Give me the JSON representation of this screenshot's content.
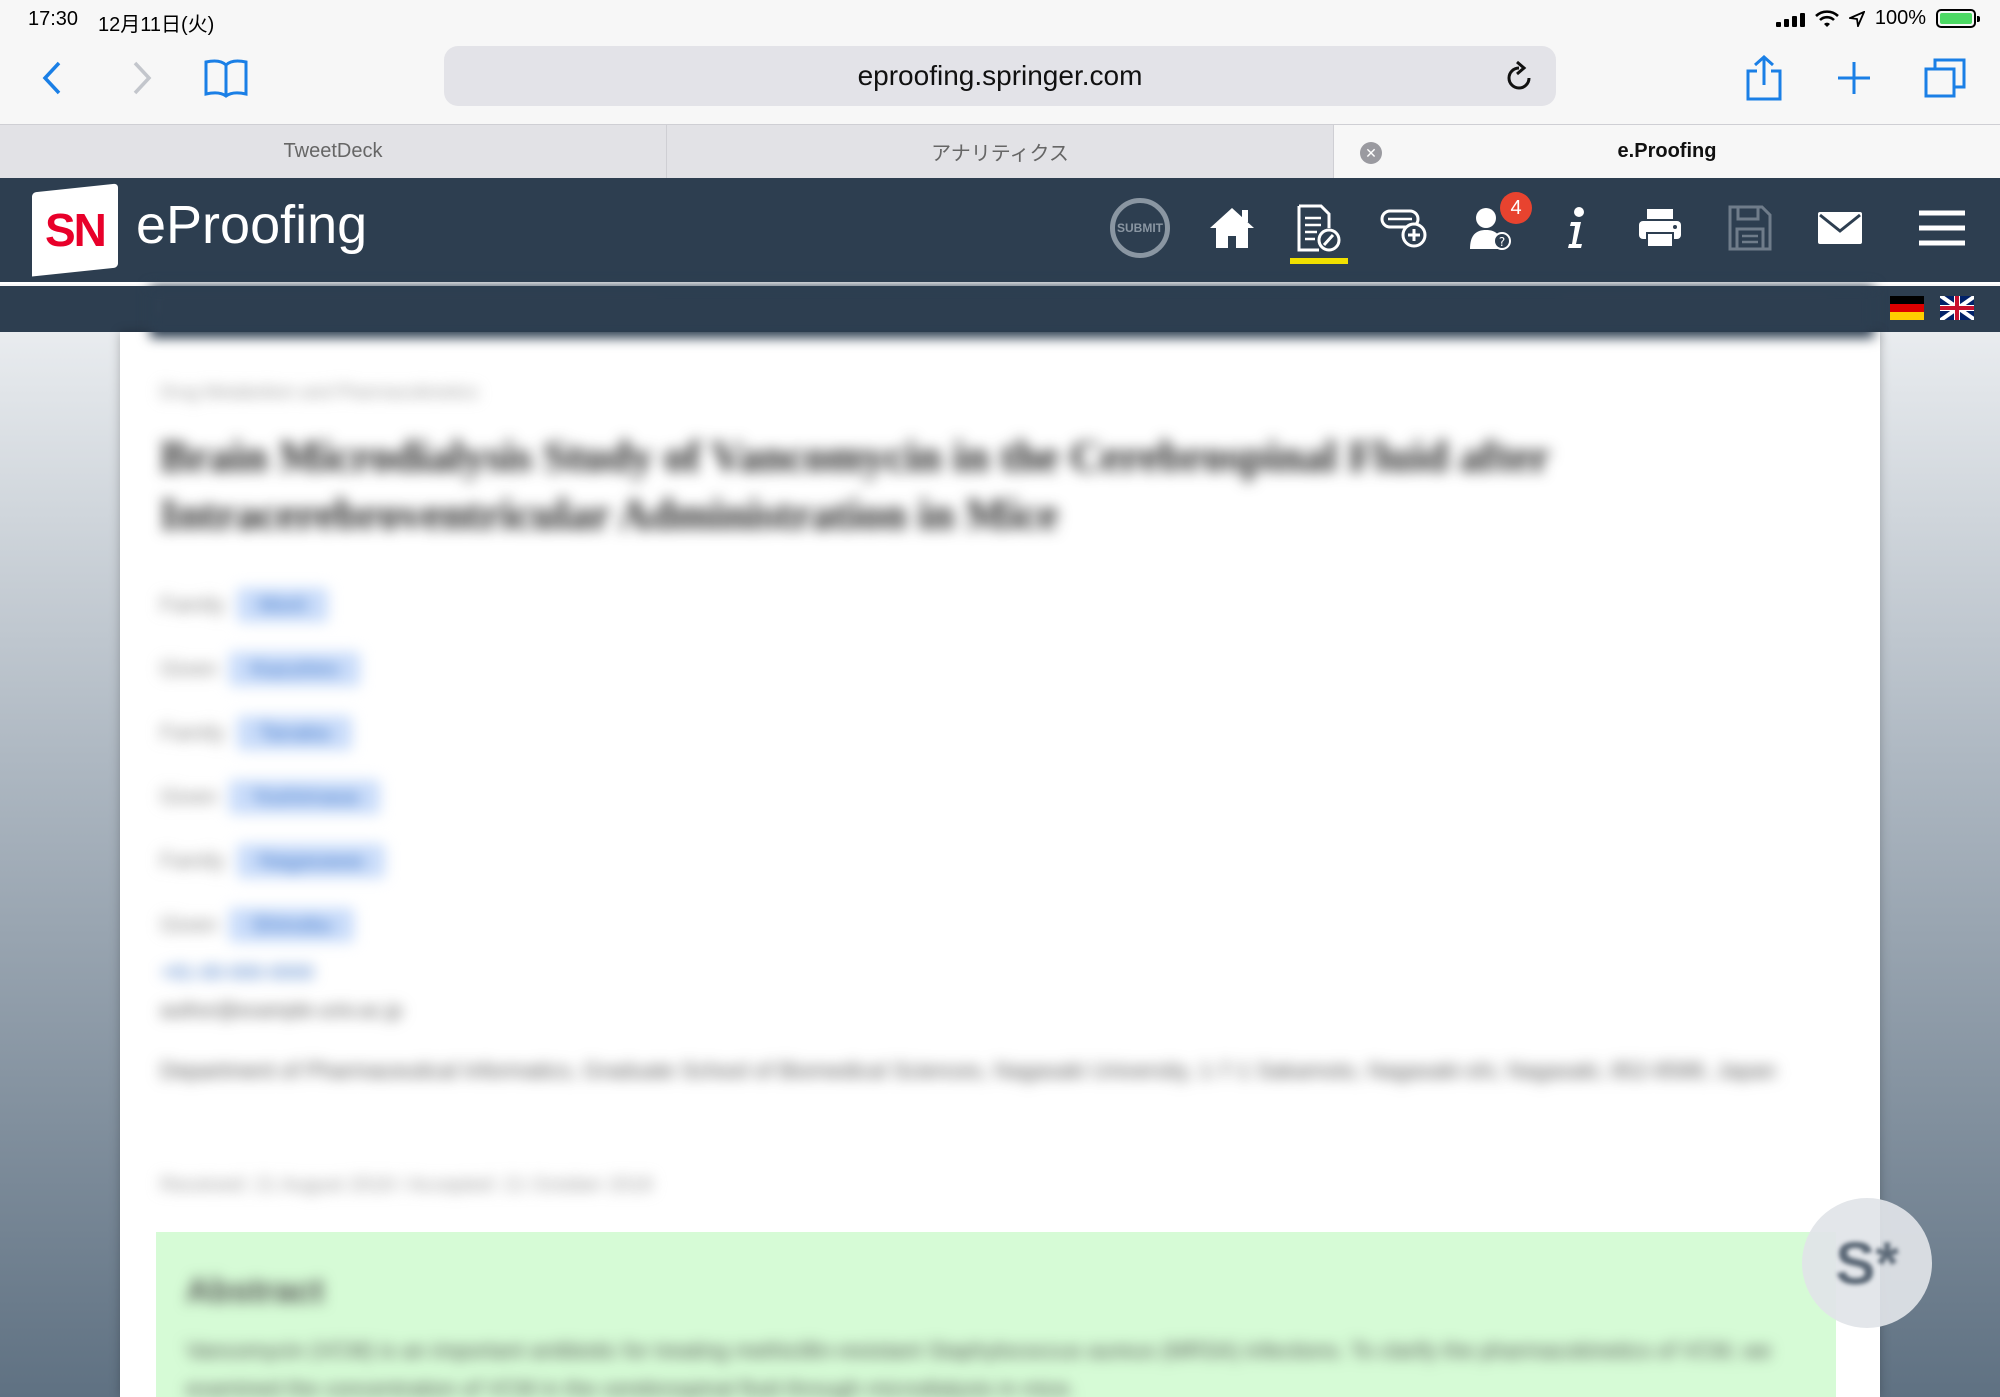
{
  "status_bar": {
    "time": "17:30",
    "date": "12月11日(火)",
    "battery": "100%"
  },
  "browser": {
    "url": "eproofing.springer.com",
    "tabs": [
      {
        "label": "TweetDeck",
        "active": false
      },
      {
        "label": "アナリティクス",
        "active": false
      },
      {
        "label": "e.Proofing",
        "active": true
      }
    ]
  },
  "app": {
    "logo_text": "SN",
    "brand": "eProofing",
    "submit_label": "SUBMIT",
    "notification_count": "4",
    "colors": {
      "header": "#2d3e50",
      "accent": "#f0e000",
      "badge": "#e8432f"
    }
  },
  "document": {
    "crumb": "Drug Metabolism and Pharmacokinetics",
    "title": "Brain Microdialysis Study of Vancomycin in the Cerebrospinal Fluid after Intracerebroventricular Administration in Mice",
    "authors": [
      {
        "role": "Family",
        "name": "Morii"
      },
      {
        "role": "Given",
        "name": "Kazuhiro"
      },
      {
        "role": "Family",
        "name": "Tanaka"
      },
      {
        "role": "Given",
        "name": "Yoshimasa"
      },
      {
        "role": "Family",
        "name": "Nagasawa"
      },
      {
        "role": "Given",
        "name": "Shinobu"
      }
    ],
    "phone": "+81-00-000-0000",
    "email": "author@example-univ.ac.jp",
    "affiliation": "Department of Pharmaceutical Informatics, Graduate School of Biomedical Sciences, Nagasaki University, 1-7-1 Sakamoto, Nagasaki-shi, Nagasaki, 852-8588, Japan",
    "received": "Received: 21 August 2018 / Accepted: 21 October 2018",
    "abstract_title": "Abstract",
    "abstract_text": "Vancomycin (VCM) is an important antibiotic for treating methicillin-resistant Staphylococcus aureus (MRSA) infections. To clarify the pharmacokinetics of VCM, we examined the concentration of VCM in the cerebrospinal fluid through microdialysis in mice."
  },
  "fab": {
    "label": "S*"
  }
}
